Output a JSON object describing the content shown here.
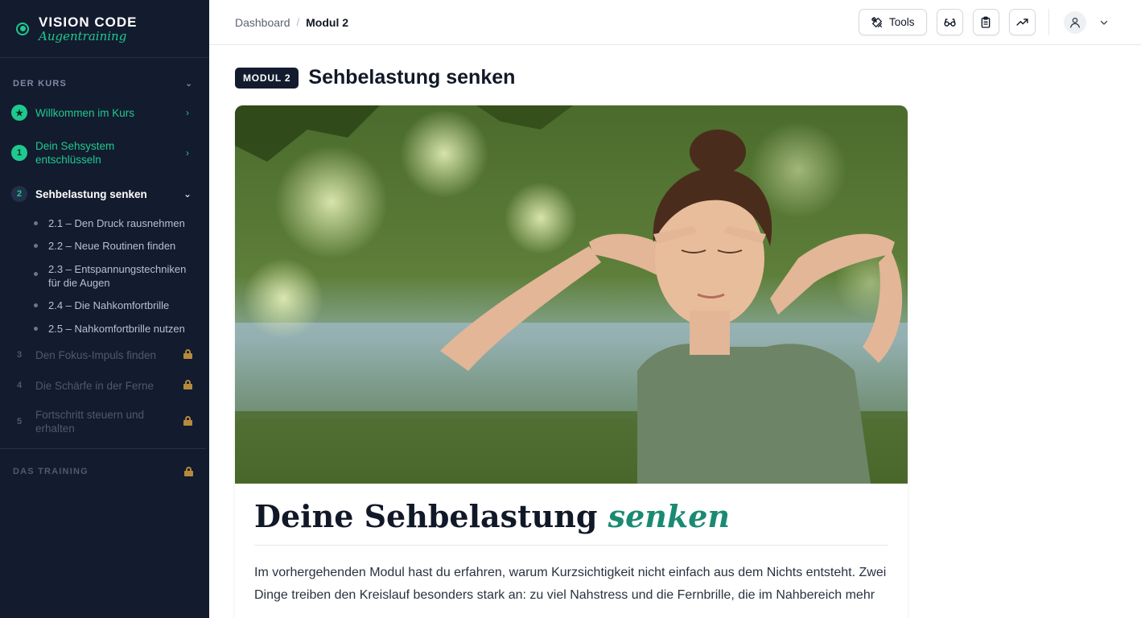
{
  "brand": {
    "title": "VISION CODE",
    "subtitle": "Augentraining"
  },
  "sidebar": {
    "section1_label": "DER KURS",
    "section2_label": "DAS TRAINING",
    "items": [
      {
        "badge": "★",
        "label": "Willkommen im Kurs",
        "state": "done"
      },
      {
        "badge": "1",
        "label": "Dein Sehsystem entschlüsseln",
        "state": "done"
      },
      {
        "badge": "2",
        "label": "Sehbelastung senken",
        "state": "active"
      },
      {
        "badge": "3",
        "label": "Den Fokus-Impuls finden",
        "state": "locked"
      },
      {
        "badge": "4",
        "label": "Die Schärfe in der Ferne",
        "state": "locked"
      },
      {
        "badge": "5",
        "label": "Fortschritt steuern und erhalten",
        "state": "locked"
      }
    ],
    "subitems": [
      "2.1 – Den Druck rausnehmen",
      "2.2 – Neue Routinen finden",
      "2.3 – Entspannungstechniken für die Augen",
      "2.4 – Die Nahkomfortbrille",
      "2.5 – Nahkomfortbrille nutzen"
    ]
  },
  "header": {
    "breadcrumb_root": "Dashboard",
    "breadcrumb_sep": "/",
    "breadcrumb_current": "Modul 2",
    "tools_label": "Tools"
  },
  "page": {
    "badge": "MODUL 2",
    "title": "Sehbelastung senken"
  },
  "article": {
    "title_plain": "Deine Sehbelastung",
    "title_accent": "senken",
    "body": "Im vorhergehenden Modul hast du erfahren, warum Kurzsichtigkeit nicht einfach aus dem Nichts entsteht. Zwei Dinge treiben den Kreislauf besonders stark an: zu viel Nahstress und die Fernbrille, die im Nahbereich mehr"
  },
  "colors": {
    "accent": "#1ec98f",
    "sidebar_bg": "#131b2e",
    "title_accent": "#1a8a72",
    "lock": "#b68a3c"
  }
}
